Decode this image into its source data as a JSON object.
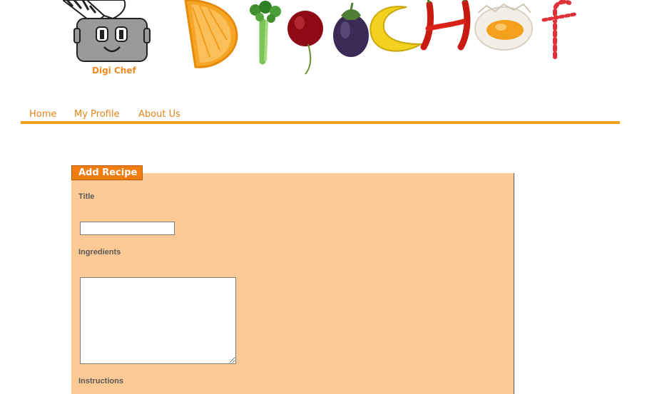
{
  "header": {
    "logo_text": "Digi Chef",
    "wordmark_items": [
      "orange-slice",
      "celery",
      "cherry",
      "eggplant",
      "banana",
      "chili-pepper",
      "egg",
      "candy-cane"
    ]
  },
  "nav": {
    "items": [
      {
        "label": "Home"
      },
      {
        "label": "My Profile"
      },
      {
        "label": "About Us"
      }
    ]
  },
  "form": {
    "heading": "Add Recipe",
    "title_label": "Title",
    "title_value": "",
    "ingredients_label": "Ingredients",
    "ingredients_value": "",
    "instructions_label": "Instructions"
  },
  "colors": {
    "accent": "#f0a01e",
    "tab": "#f07d10",
    "panel": "#fdc995",
    "nav_text": "#e4851a",
    "logo_text": "#ef8a1f"
  }
}
